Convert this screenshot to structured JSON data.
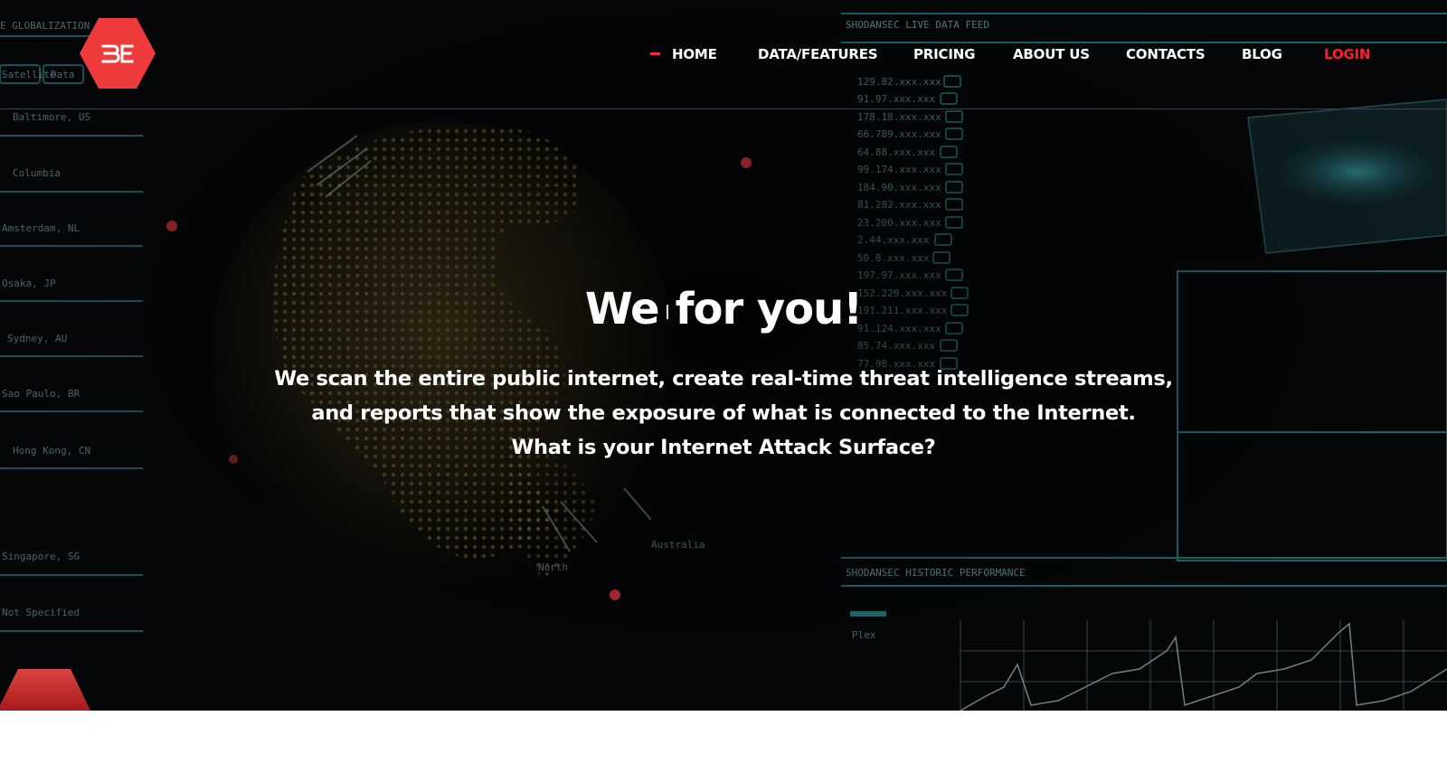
{
  "brand": {
    "logo_text": "BE",
    "accent_color": "#ef3b3b"
  },
  "nav": {
    "items": [
      {
        "label": "HOME",
        "active": true
      },
      {
        "label": "DATA/FEATURES"
      },
      {
        "label": "PRICING"
      },
      {
        "label": "ABOUT US"
      },
      {
        "label": "CONTACTS"
      },
      {
        "label": "BLOG"
      },
      {
        "label": "LOGIN",
        "color": "#ff1f2a"
      }
    ]
  },
  "hero": {
    "title_left": "We",
    "title_right": "for you!",
    "subtitle_lines": [
      "We scan the entire public internet, create real-time threat intelligence streams,",
      "and reports that show the exposure of what is connected to the Internet.",
      "What is your Internet Attack Surface?"
    ]
  },
  "background": {
    "left_panel_title": "E GLOBALIZATION",
    "left_panel_tabs": [
      "Satellite",
      "Data"
    ],
    "left_panel_rows": [
      "Baltimore, US",
      "Columbia",
      "Amsterdam, NL",
      "Osaka, JP",
      "Sydney, AU",
      "Sao Paulo, BR",
      "Hong Kong, CN",
      "Singapore, SG",
      "Not Specified"
    ],
    "feed_title": "SHODANSEC LIVE DATA FEED",
    "feed_rows": [
      "129.82.xxx.xxx",
      "91.97.xxx.xxx",
      "178.18.xxx.xxx",
      "66.789.xxx.xxx",
      "64.88.xxx.xxx",
      "99.174.xxx.xxx",
      "184.90.xxx.xxx",
      "81.282.xxx.xxx",
      "23.200.xxx.xxx",
      "2.44.xxx.xxx",
      "50.8.xxx.xxx",
      "197.97.xxx.xxx",
      "152.229.xxx.xxx",
      "191.211.xxx.xxx",
      "91.124.xxx.xxx",
      "85.74.xxx.xxx",
      "77.98.xxx.xxx"
    ],
    "perf_title": "SHODANSEC HISTORIC PERFORMANCE",
    "perf_label": "Plex",
    "globe_labels": [
      "North",
      "Australia"
    ]
  }
}
